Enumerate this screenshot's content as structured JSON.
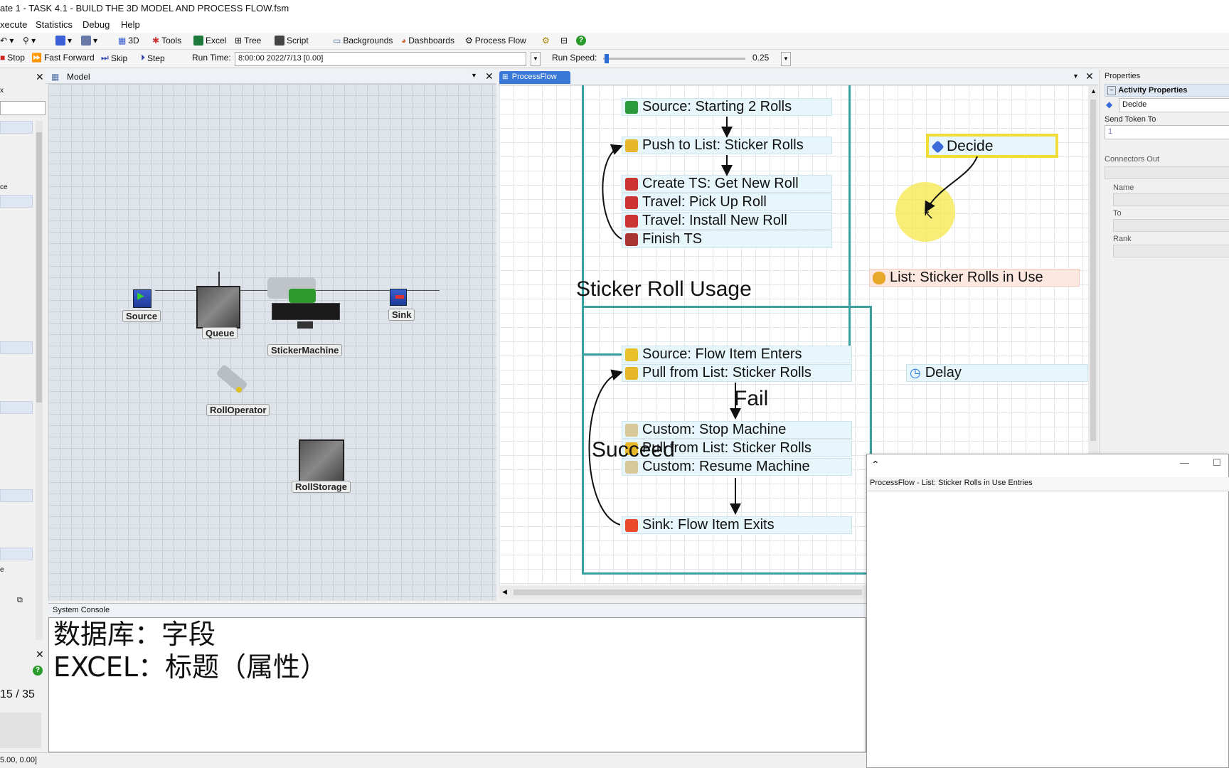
{
  "window": {
    "title": "ate 1 - TASK 4.1 - BUILD THE 3D MODEL AND PROCESS FLOW.fsm"
  },
  "menu": [
    "xecute",
    "Statistics",
    "Debug",
    "Help"
  ],
  "toolbar1": {
    "items": [
      "3D",
      "Tools",
      "Excel",
      "Tree",
      "Script",
      "Backgrounds",
      "Dashboards",
      "Process Flow"
    ]
  },
  "toolbar2": {
    "stop": "Stop",
    "fast_forward": "Fast Forward",
    "skip": "Skip",
    "step": "Step",
    "run_time_label": "Run Time:",
    "run_time_value": "8:00:00  2022/7/13  [0.00]",
    "run_speed_label": "Run Speed:",
    "run_speed_value": "0.25",
    "run_speed_fraction": 0.01
  },
  "left_strip": {
    "label1": "ce",
    "label2": "e",
    "counter": "15 / 35"
  },
  "model": {
    "tab": "Model",
    "objects": {
      "source": "Source",
      "queue": "Queue",
      "sticker_machine": "StickerMachine",
      "sink": "Sink",
      "roll_operator": "RollOperator",
      "roll_storage": "RollStorage"
    }
  },
  "processflow": {
    "tab": "ProcessFlow",
    "top_group": {
      "activities": [
        "Source: Starting 2 Rolls",
        "Push to List: Sticker Rolls",
        "Create TS: Get New Roll",
        "Travel: Pick Up Roll",
        "Travel: Install New Roll",
        "Finish TS"
      ]
    },
    "usage_title": "Sticker Roll Usage",
    "usage_group": {
      "activities": [
        "Source: Flow Item Enters",
        "Pull from List: Sticker Rolls",
        "Custom: Stop Machine",
        "Pull from List: Sticker Rolls",
        "Custom: Resume Machine",
        "Sink: Flow Item Exits"
      ],
      "fail_label": "Fail",
      "succeed_label": "Succeed"
    },
    "decide": "Decide",
    "list_shared": "List: Sticker Rolls in Use",
    "delay": "Delay"
  },
  "properties": {
    "header": "Properties",
    "section": "Activity Properties",
    "name_value": "Decide",
    "send_token_label": "Send Token To",
    "send_token_value": "1",
    "connectors_out": "Connectors Out",
    "name_label": "Name",
    "to_label": "To",
    "rank_label": "Rank"
  },
  "console": {
    "tab": "System Console",
    "lines": [
      "数据库：字段",
      "EXCEL：标题（属性）"
    ]
  },
  "float_window": {
    "subtitle": "ProcessFlow - List: Sticker Rolls in Use Entries"
  },
  "status": {
    "coords": "5.00, 0.00]"
  },
  "colors": {
    "pf_group_border": "#3aa0a0",
    "activity_bg": "#e6f6fb",
    "list_bg": "#fde8e0",
    "highlight": "#f5e84a"
  }
}
